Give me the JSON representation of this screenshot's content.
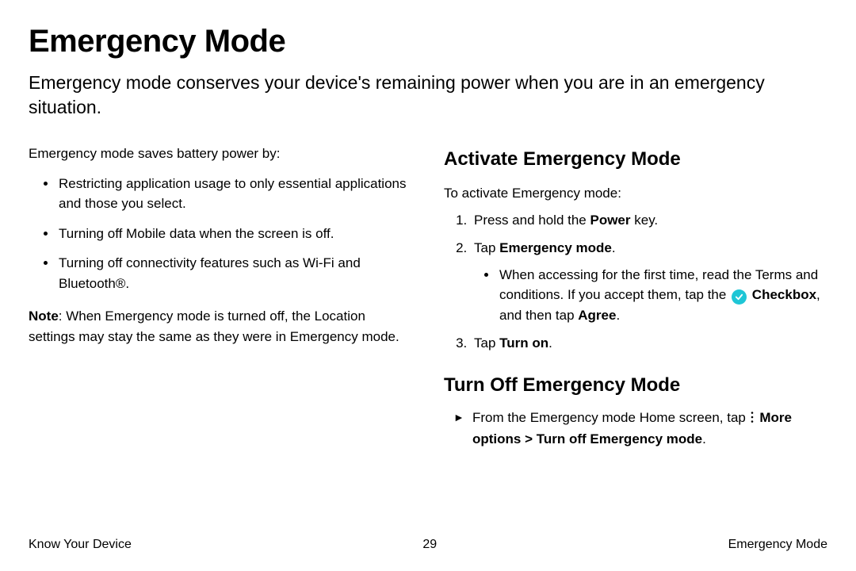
{
  "title": "Emergency Mode",
  "intro": "Emergency mode conserves your device's remaining power when you are in an emergency situation.",
  "left": {
    "lead": "Emergency mode saves battery power by:",
    "bullets": [
      "Restricting application usage to only essential applications and those you select.",
      "Turning off Mobile data when the screen is off.",
      "Turning off connectivity features such as Wi-Fi and Bluetooth®."
    ],
    "note_label": "Note",
    "note_text": ": When Emergency mode is turned off, the Location settings may stay the same as they were in Emergency mode."
  },
  "activate": {
    "heading": "Activate Emergency Mode",
    "lead": "To activate Emergency mode:",
    "step1_pre": "Press and hold the ",
    "step1_bold": "Power",
    "step1_post": " key.",
    "step2_pre": "Tap ",
    "step2_bold": "Emergency mode",
    "step2_post": ".",
    "sub_pre": "When accessing for the first time, read the Terms and conditions. If you accept them, tap the ",
    "sub_bold1": "Checkbox",
    "sub_mid": ", and then tap ",
    "sub_bold2": "Agree",
    "sub_post": ".",
    "step3_pre": "Tap ",
    "step3_bold": "Turn on",
    "step3_post": "."
  },
  "turnoff": {
    "heading": "Turn Off Emergency Mode",
    "line_pre": "From the Emergency mode Home screen, tap ",
    "line_bold": "More options > Turn off Emergency mode",
    "line_post": "."
  },
  "footer": {
    "left": "Know Your Device",
    "center": "29",
    "right": "Emergency Mode"
  }
}
